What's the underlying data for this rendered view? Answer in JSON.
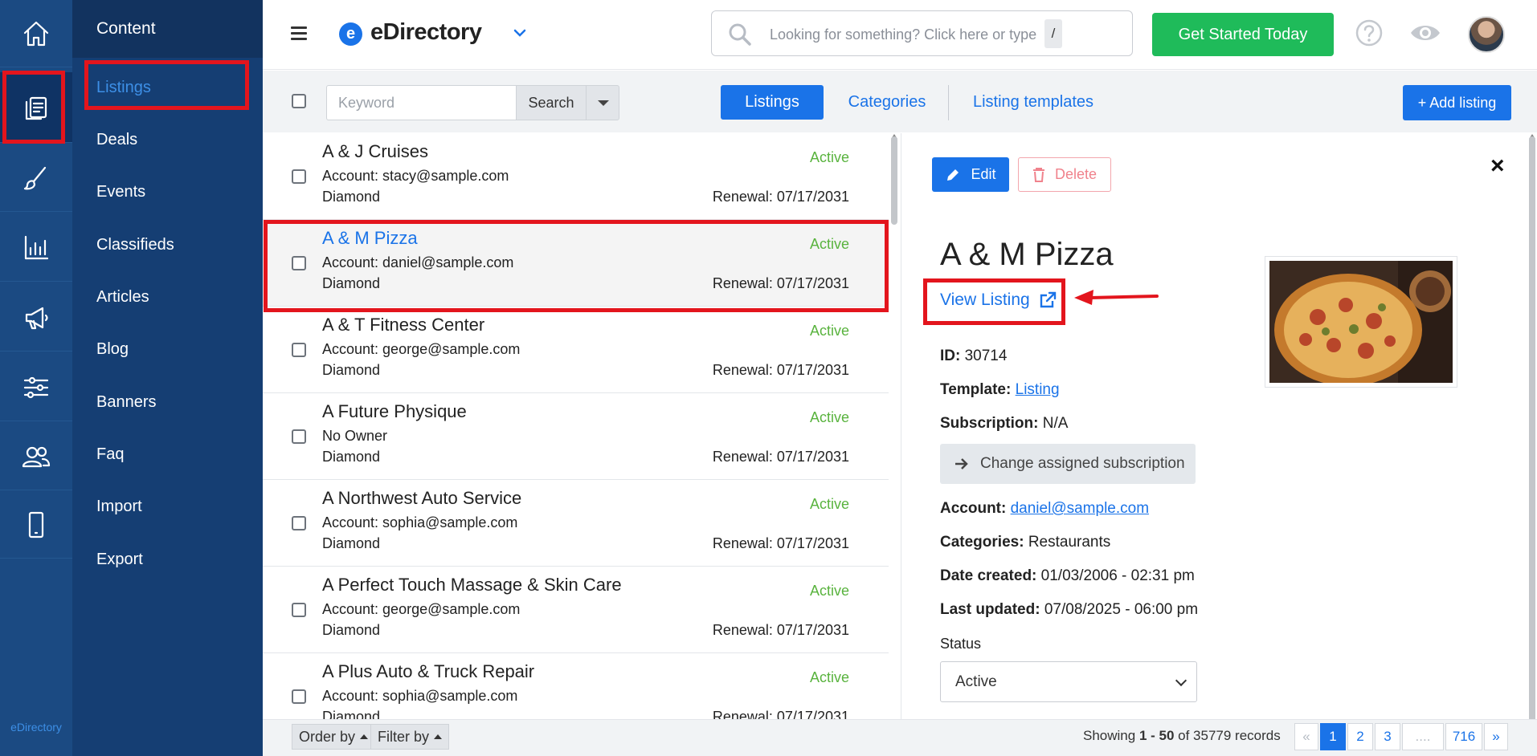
{
  "rail": {
    "items": [
      "home-icon",
      "content-icon",
      "design-icon",
      "reports-icon",
      "promote-icon",
      "settings-icon",
      "users-icon",
      "mobile-icon"
    ],
    "brand": "eDirectory"
  },
  "subnav": {
    "title": "Content",
    "items": [
      "Listings",
      "Deals",
      "Events",
      "Classifieds",
      "Articles",
      "Blog",
      "Banners",
      "Faq",
      "Import",
      "Export"
    ]
  },
  "topbar": {
    "logo_letter": "e",
    "logo_text": "eDirectory",
    "search_placeholder": "Looking for something? Click here or type",
    "search_shortcut": "/",
    "cta": "Get Started Today"
  },
  "toolbar": {
    "keyword_placeholder": "Keyword",
    "search_label": "Search",
    "tabs": [
      "Listings",
      "Categories",
      "Listing templates"
    ],
    "add_label": "+ Add listing"
  },
  "listings": [
    {
      "name": "A & J Cruises",
      "account": "Account: stacy@sample.com",
      "level": "Diamond",
      "status": "Active",
      "renewal": "Renewal: 07/17/2031"
    },
    {
      "name": "A & M Pizza",
      "account": "Account: daniel@sample.com",
      "level": "Diamond",
      "status": "Active",
      "renewal": "Renewal: 07/17/2031"
    },
    {
      "name": "A & T Fitness Center",
      "account": "Account: george@sample.com",
      "level": "Diamond",
      "status": "Active",
      "renewal": "Renewal: 07/17/2031"
    },
    {
      "name": "A Future Physique",
      "account": "No Owner",
      "level": "Diamond",
      "status": "Active",
      "renewal": "Renewal: 07/17/2031"
    },
    {
      "name": "A Northwest Auto Service",
      "account": "Account: sophia@sample.com",
      "level": "Diamond",
      "status": "Active",
      "renewal": "Renewal: 07/17/2031"
    },
    {
      "name": "A Perfect Touch Massage & Skin Care",
      "account": "Account: george@sample.com",
      "level": "Diamond",
      "status": "Active",
      "renewal": "Renewal: 07/17/2031"
    },
    {
      "name": "A Plus Auto & Truck Repair",
      "account": "Account: sophia@sample.com",
      "level": "Diamond",
      "status": "Active",
      "renewal": "Renewal: 07/17/2031"
    }
  ],
  "detail": {
    "edit_label": "Edit",
    "delete_label": "Delete",
    "close": "×",
    "title": "A & M Pizza",
    "view_link": "View Listing",
    "id_label": "ID:",
    "id_value": "30714",
    "template_label": "Template:",
    "template_value": "Listing",
    "subscription_label": "Subscription:",
    "subscription_value": "N/A",
    "change_sub": "Change assigned subscription",
    "account_label": "Account:",
    "account_value": "daniel@sample.com",
    "categories_label": "Categories:",
    "categories_value": "Restaurants",
    "created_label": "Date created:",
    "created_value": "01/03/2006 - 02:31 pm",
    "updated_label": "Last updated:",
    "updated_value": "07/08/2025 - 06:00 pm",
    "status_label": "Status",
    "status_value": "Active"
  },
  "footer": {
    "order_by": "Order by",
    "filter_by": "Filter by",
    "showing_prefix": "Showing ",
    "showing_range": "1 - 50",
    "showing_suffix": " of 35779 records",
    "pages": [
      "«",
      "1",
      "2",
      "3",
      "....",
      "716",
      "»"
    ]
  },
  "colors": {
    "rail": "#1b4a82",
    "accent": "#1a73e8",
    "cta": "#1fbb5a",
    "status_active": "#59b33e",
    "annotation": "#e3151d"
  }
}
